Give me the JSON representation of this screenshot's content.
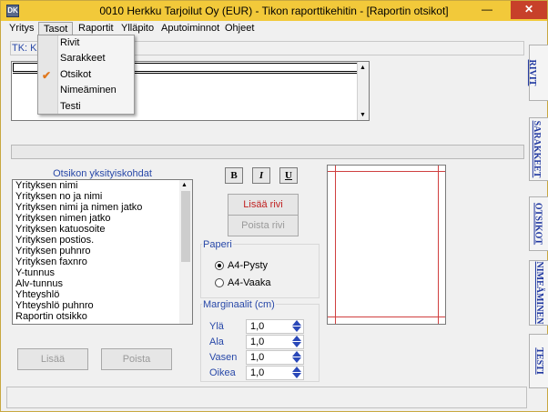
{
  "window": {
    "title": "0010  Herkku Tarjoilut Oy (EUR) - Tikon raporttikehitin - [Raportin otsikot]",
    "icon": "DK"
  },
  "menubar": [
    "Yritys",
    "Tasot",
    "Raportit",
    "Ylläpito",
    "Aputoiminnot",
    "Ohjeet"
  ],
  "tasot_menu": {
    "items": [
      "Rivit",
      "Sarakkeet",
      "Otsikot",
      "Nimeäminen",
      "Testi"
    ],
    "checked": "Otsikot"
  },
  "tk_label": "TK: KP",
  "side_tabs": [
    "RIVIT",
    "SARAKKEET",
    "OTSIKOT",
    "NIMEÄMINEN",
    "TESTI"
  ],
  "fields_list": {
    "label": "Otsikon yksityiskohdat",
    "items": [
      "Yrityksen nimi",
      "Yrityksen no ja nimi",
      "Yrityksen nimi ja nimen jatko",
      "Yrityksen nimen jatko",
      "Yrityksen katuosoite",
      "Yrityksen postios.",
      "Yrityksen puhnro",
      "Yrityksen faxnro",
      "Y-tunnus",
      "Alv-tunnus",
      "Yhteyshlö",
      "Yhteyshlö puhnro",
      "Raportin otsikko"
    ]
  },
  "buttons": {
    "add": "Lisää",
    "remove": "Poista",
    "add_row": "Lisää rivi",
    "remove_row": "Poista rivi",
    "bold": "B",
    "italic": "I",
    "underline": "U"
  },
  "paper": {
    "label": "Paperi",
    "options": [
      "A4-Pysty",
      "A4-Vaaka"
    ],
    "selected": "A4-Pysty"
  },
  "margins": {
    "label": "Marginaalit (cm)",
    "fields": [
      {
        "name": "Ylä",
        "value": "1,0"
      },
      {
        "name": "Ala",
        "value": "1,0"
      },
      {
        "name": "Vasen",
        "value": "1,0"
      },
      {
        "name": "Oikea",
        "value": "1,0"
      }
    ]
  },
  "colors": {
    "title_bar": "#f2c93a",
    "label_blue": "#2848a8",
    "tab_text": "#1e36a0",
    "preview_margin": "#d04040",
    "close_button": "#c7402a"
  }
}
